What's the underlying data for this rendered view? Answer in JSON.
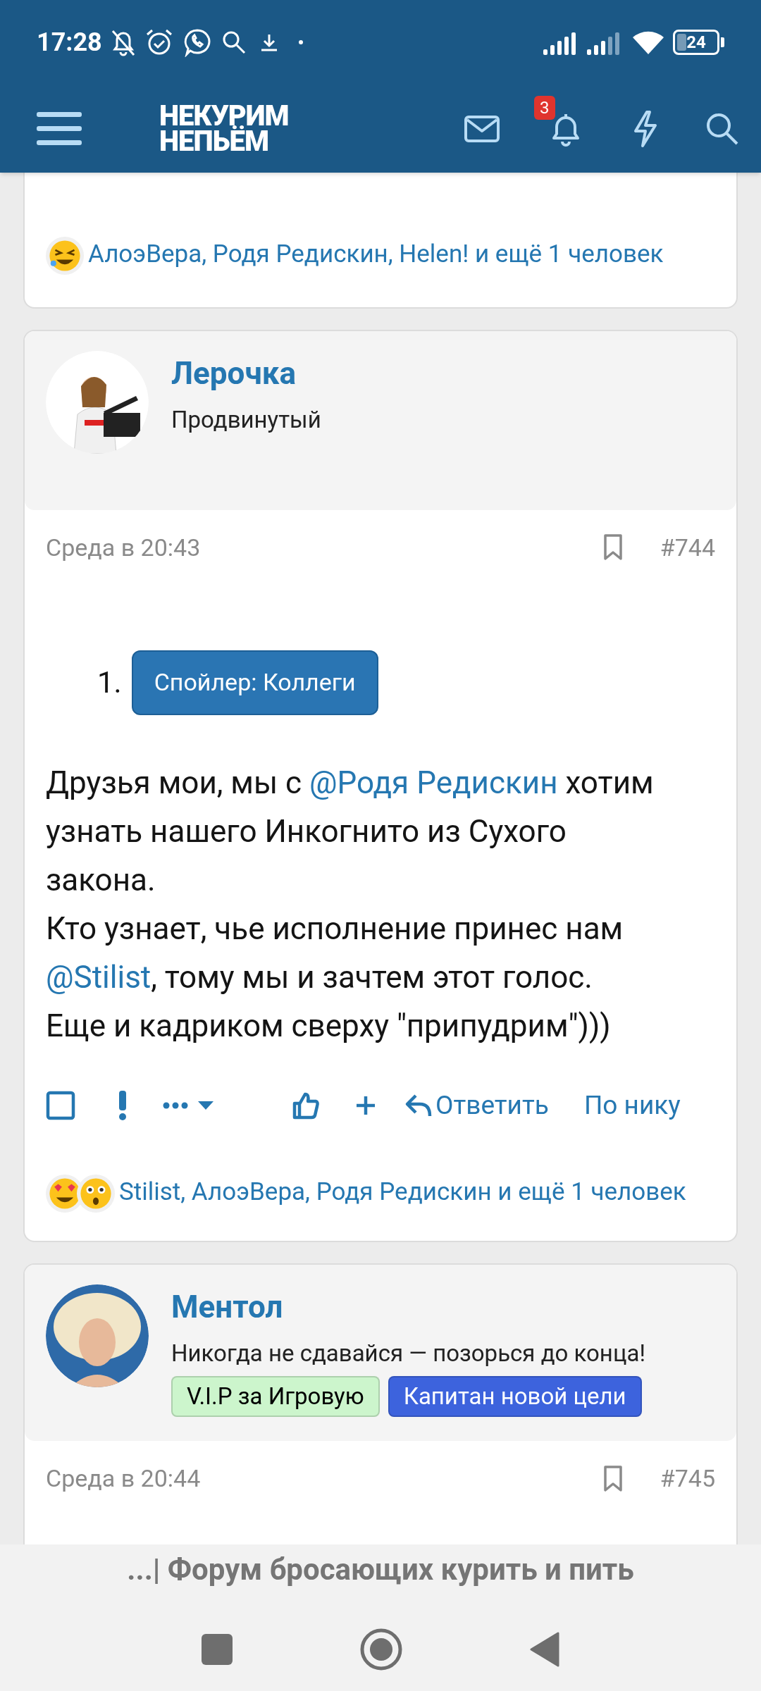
{
  "status_bar": {
    "time": "17:28",
    "battery": "24"
  },
  "app_bar": {
    "logo_lines": [
      "НЕКУРИМ",
      "НЕПЬЁМ"
    ],
    "notification_count": "3"
  },
  "posts": [
    {
      "kind": "tail",
      "reactions": {
        "icons": [
          {
            "kind": "rofl"
          }
        ],
        "text": "АлоэВера, Родя Редискин, Helen! и ещё 1 человек"
      }
    },
    {
      "kind": "full",
      "author": "Лерочка",
      "rank": "Продвинутый",
      "date": "Среда в 20:43",
      "number": "#744",
      "spoiler": {
        "marker": "1.",
        "label": "Спойлер: Коллеги"
      },
      "body": [
        [
          {
            "kind": "text",
            "text": "Друзья мои, мы с "
          },
          {
            "kind": "mention",
            "text": "@Родя Редискин"
          },
          {
            "kind": "text",
            "text": " хотим узнать нашего Инкогнито из Сухого закона."
          }
        ],
        [
          {
            "kind": "text",
            "text": "Кто узнает, чье исполнение принес нам "
          },
          {
            "kind": "mention",
            "text": "@Stilist"
          },
          {
            "kind": "text",
            "text": ", тому мы и зачтем этот голос."
          }
        ],
        [
          {
            "kind": "text",
            "text": "Еще и кадриком сверху \"припудрим\")))"
          }
        ]
      ],
      "actions": {
        "reply": "Ответить",
        "by_nick": "По нику"
      },
      "reactions": {
        "icons": [
          {
            "kind": "heart-eyes"
          },
          {
            "kind": "astonished"
          }
        ],
        "text": "Stilist, АлоэВера, Родя Редискин и ещё 1 человек"
      }
    },
    {
      "kind": "head",
      "author": "Ментол",
      "rank": "Никогда не сдавайся — позорься до конца!",
      "badges": [
        {
          "label": "V.I.P за Игровую",
          "color": "#ccf5cc"
        },
        {
          "label": "Капитан новой цели",
          "color": "#3d63dd"
        }
      ],
      "date": "Среда в 20:44",
      "number": "#745"
    }
  ],
  "footer": {
    "page_title": "...| Форум бросающих курить и пить"
  }
}
